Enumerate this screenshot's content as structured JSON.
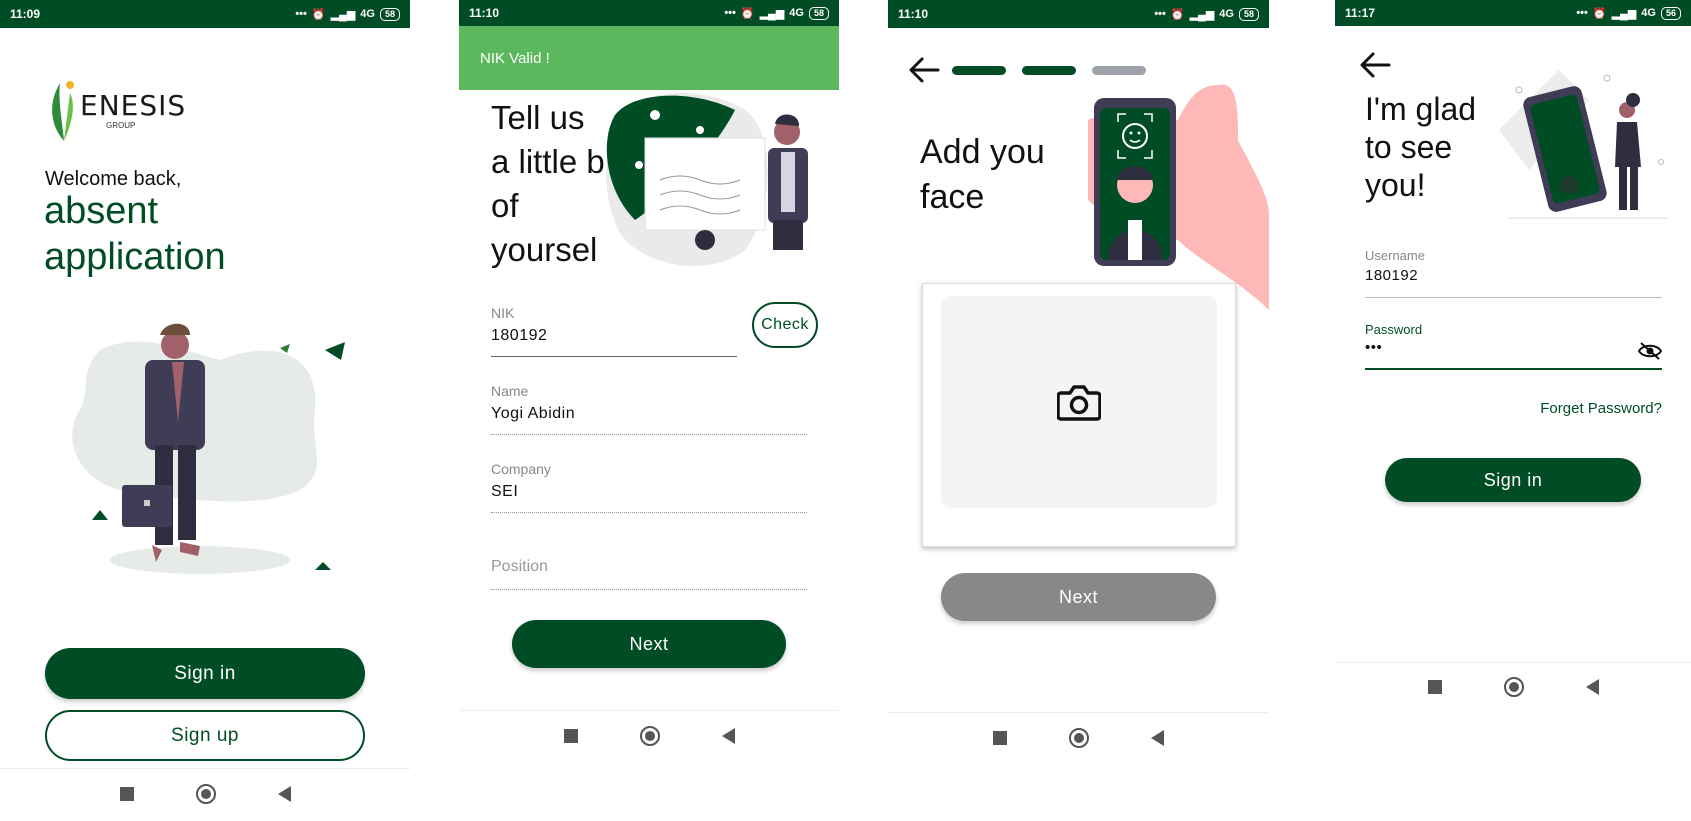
{
  "screen1": {
    "status": {
      "time": "11:09",
      "network": "4G",
      "battery": "58"
    },
    "logo_text": "ENESIS",
    "logo_sub": "GROUP",
    "welcome": "Welcome back,",
    "app_name_line1": "absent",
    "app_name_line2": "application",
    "signin_label": "Sign in",
    "signup_label": "Sign up"
  },
  "screen2": {
    "status": {
      "time": "11:10",
      "network": "4G",
      "battery": "58"
    },
    "snackbar": "NIK Valid !",
    "title_lines": [
      "Tell us",
      "a little b",
      "of",
      "yoursel"
    ],
    "fields": [
      {
        "label": "NIK",
        "value": "180192"
      },
      {
        "label": "Name",
        "value": "Yogi Abidin"
      },
      {
        "label": "Company",
        "value": "SEI"
      },
      {
        "label": "Position",
        "value": ""
      }
    ],
    "check_label": "Check",
    "next_label": "Next"
  },
  "screen3": {
    "status": {
      "time": "11:10",
      "network": "4G",
      "battery": "58"
    },
    "title_line1": "Add you",
    "title_line2": "face",
    "next_label": "Next",
    "steps_done": 2,
    "steps_total": 3
  },
  "screen4": {
    "status": {
      "time": "11:17",
      "network": "4G",
      "battery": "56"
    },
    "title_lines": [
      "I'm glad",
      "to see",
      "you!"
    ],
    "username_label": "Username",
    "username_value": "180192",
    "password_label": "Password",
    "password_value": "•••",
    "forget_label": "Forget Password?",
    "signin_label": "Sign in"
  },
  "colors": {
    "brand": "#004d25",
    "snackbar": "#5cb85c",
    "disabled": "#888888"
  }
}
